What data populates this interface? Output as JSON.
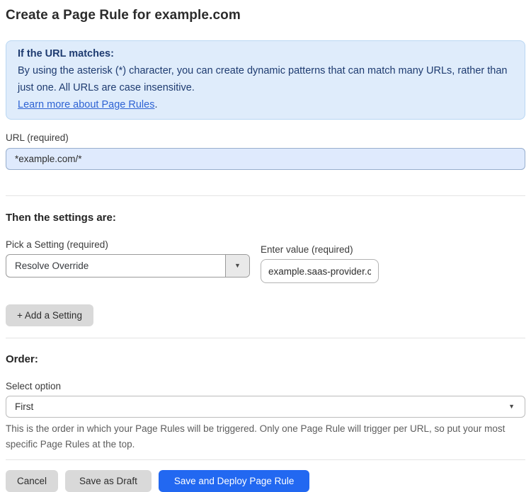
{
  "page": {
    "title": "Create a Page Rule for example.com"
  },
  "info_box": {
    "heading": "If the URL matches:",
    "body": "By using the asterisk (*) character, you can create dynamic patterns that can match many URLs, rather than just one. All URLs are case insensitive.",
    "link_label": "Learn more about Page Rules",
    "link_suffix": "."
  },
  "url_field": {
    "label": "URL (required)",
    "value": "*example.com/*"
  },
  "settings_section": {
    "heading": "Then the settings are:",
    "setting_picker": {
      "label": "Pick a Setting (required)",
      "selected": "Resolve Override"
    },
    "value_field": {
      "label": "Enter value (required)",
      "value": "example.saas-provider.c"
    },
    "add_setting_label": "+ Add a Setting"
  },
  "order_section": {
    "heading": "Order:",
    "select_label": "Select option",
    "selected": "First",
    "help_text": "This is the order in which your Page Rules will be triggered. Only one Page Rule will trigger per URL, so put your most specific Page Rules at the top."
  },
  "footer": {
    "cancel_label": "Cancel",
    "save_draft_label": "Save as Draft",
    "save_deploy_label": "Save and Deploy Page Rule"
  },
  "icons": {
    "dropdown_caret": "▼"
  },
  "colors": {
    "primary_button_blue": "#2268f1",
    "info_box_background": "#dfecfb",
    "info_box_border": "#b9d7f3",
    "info_text_navy": "#1e3b70",
    "link_blue": "#2e63d4",
    "url_input_background": "#dfeafd",
    "gray_button": "#d9d9d9"
  }
}
